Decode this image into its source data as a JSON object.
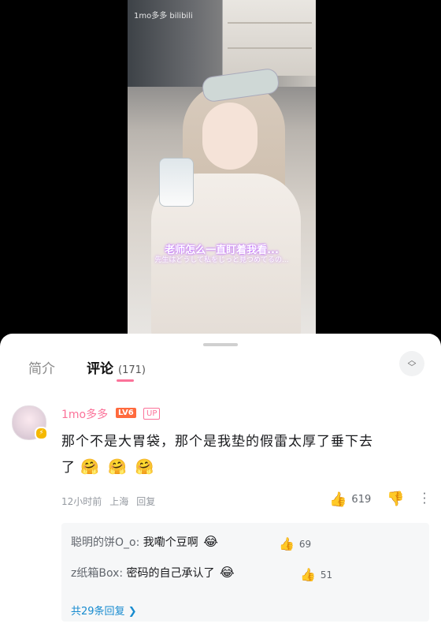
{
  "video": {
    "watermark": "1mo多多 bilibili",
    "subtitle_cn": "老师怎么一直盯着我看...",
    "subtitle_jp": "先生はどうして私をじっと見つめてるの..."
  },
  "tabs": {
    "intro": "简介",
    "comments": "评论",
    "comment_count": "(171)"
  },
  "comment": {
    "username": "1mo多多",
    "level": "LV6",
    "up_badge": "UP",
    "text_line1": "那个不是大胃袋，那个是我垫的假雷太厚了垂下去",
    "text_line2": "了",
    "emojis": [
      "🤗",
      "🤗",
      "🤗"
    ],
    "time": "12小时前",
    "location": "上海",
    "reply_label": "回复",
    "likes": "619"
  },
  "replies": [
    {
      "name": "聪明的饼O_o:",
      "text": "我嘞个豆啊",
      "emoji": "😂",
      "likes": "69"
    },
    {
      "name": "z纸箱Box:",
      "text": "密码的自己承认了",
      "emoji": "😂",
      "likes": "51"
    }
  ],
  "view_more": "共29条回复",
  "icons": {
    "like": "thumbs-up-icon",
    "dislike": "thumbs-down-icon",
    "more": "more-vertical-icon",
    "collapse": "collapse-chevron-icon"
  },
  "colors": {
    "accent": "#fb7299",
    "link": "#178bcf",
    "level": "#ff6a3d"
  }
}
